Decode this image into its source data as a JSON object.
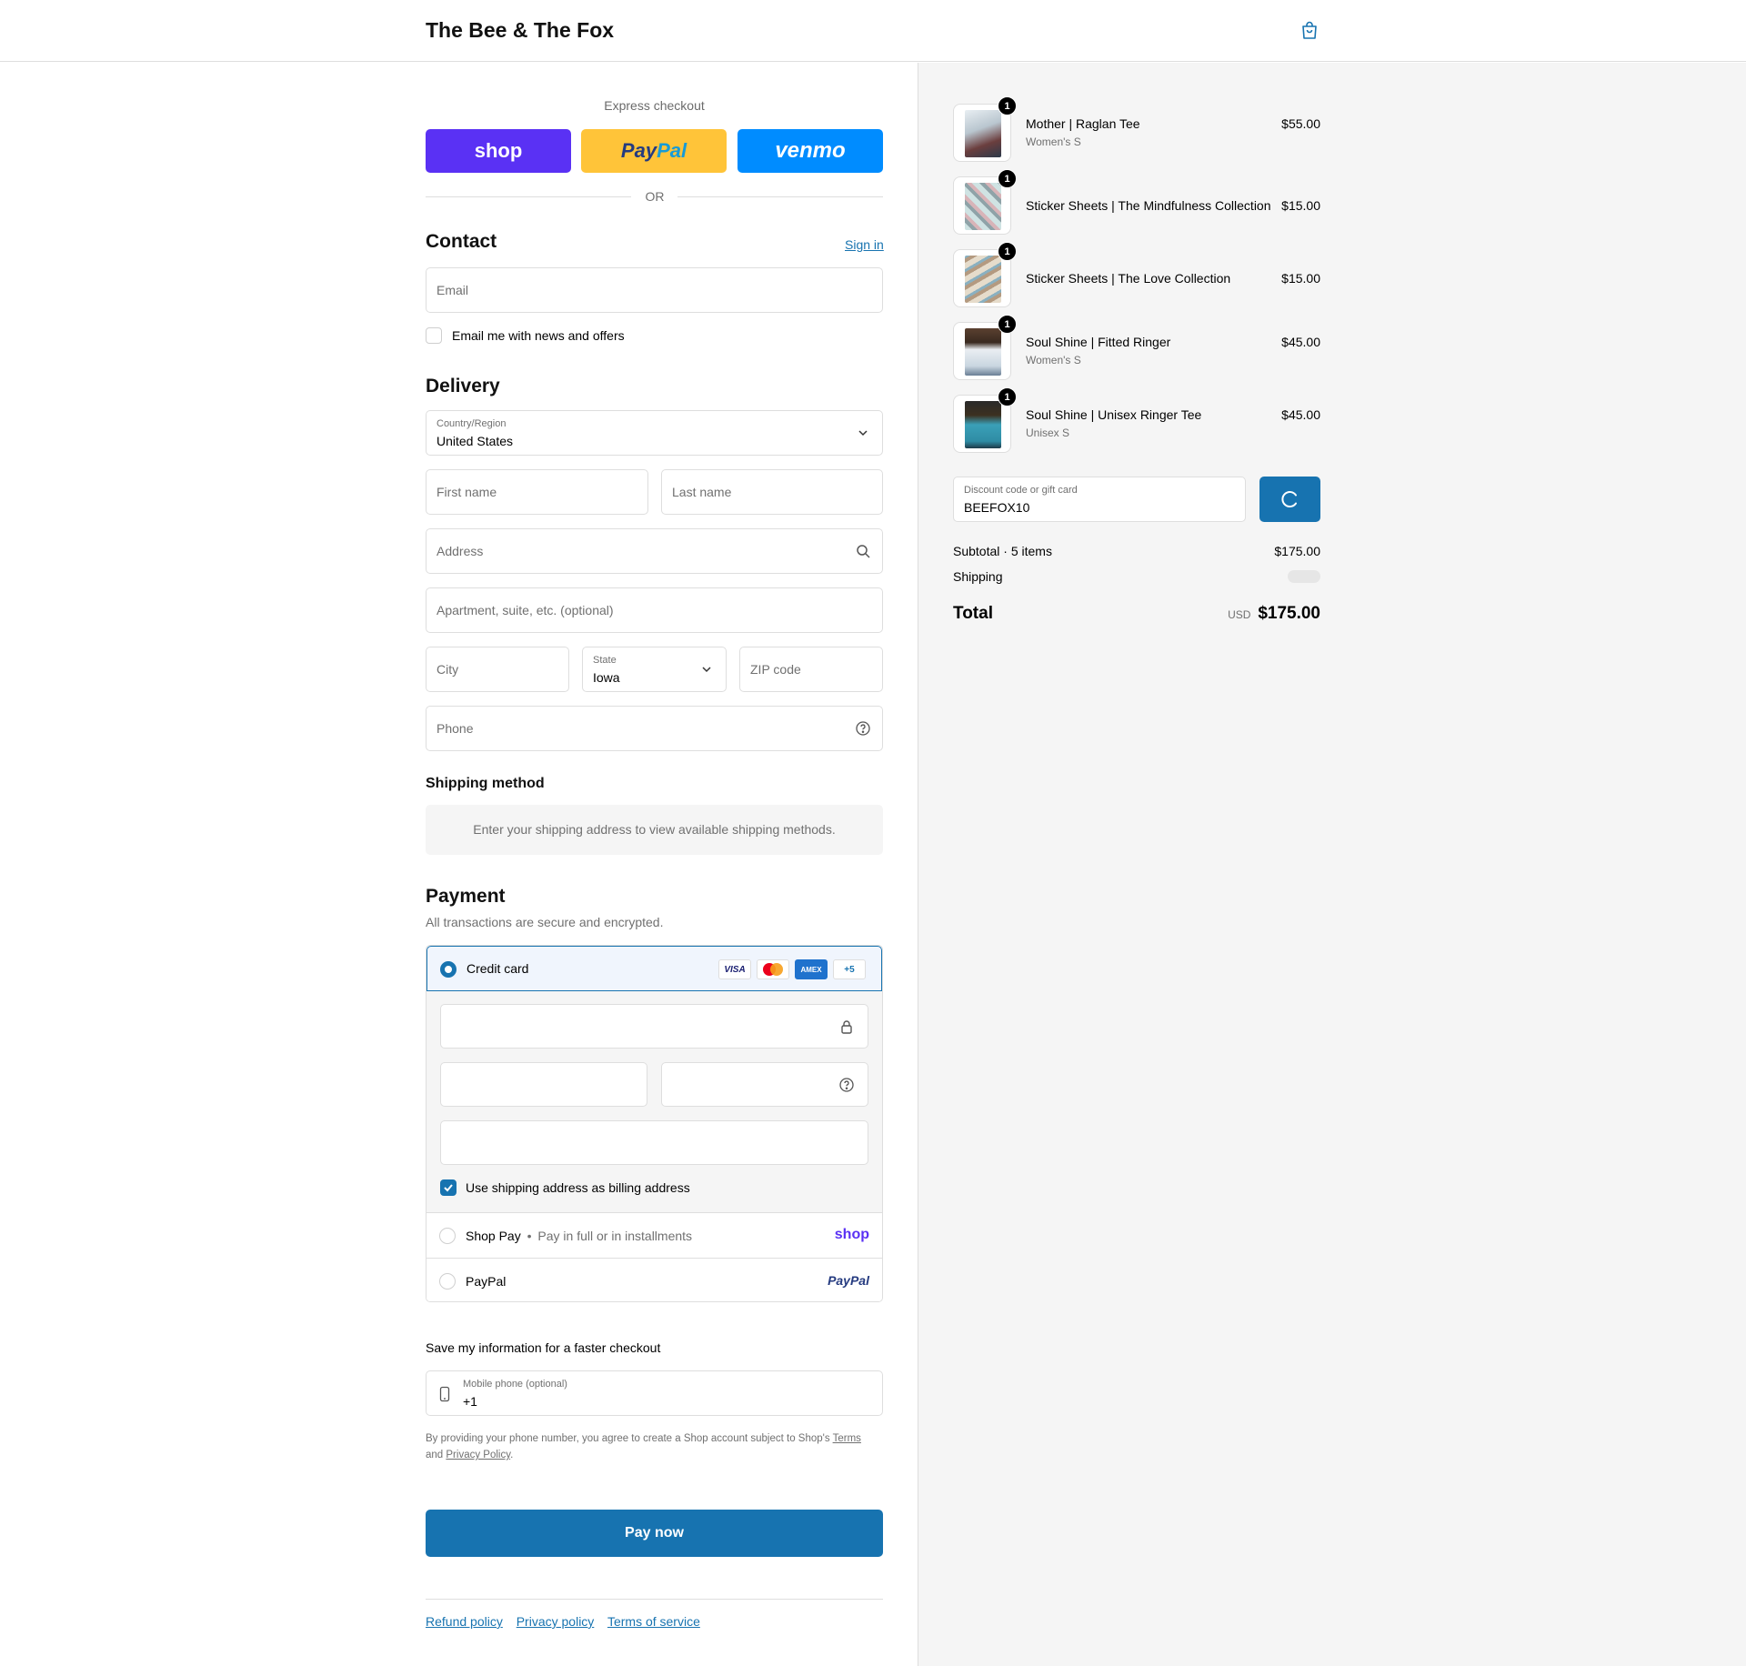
{
  "store": {
    "name": "The Bee & The Fox"
  },
  "express": {
    "title": "Express checkout",
    "shop_label": "shop",
    "paypal_label_a": "Pay",
    "paypal_label_b": "Pal",
    "venmo_label": "venmo",
    "or_label": "OR"
  },
  "contact": {
    "heading": "Contact",
    "sign_in": "Sign in",
    "email_placeholder": "Email",
    "news_label": "Email me with news and offers"
  },
  "delivery": {
    "heading": "Delivery",
    "country_label": "Country/Region",
    "country_value": "United States",
    "first_name": "First name",
    "last_name": "Last name",
    "address": "Address",
    "apartment": "Apartment, suite, etc. (optional)",
    "city": "City",
    "state_label": "State",
    "state_value": "Iowa",
    "zip": "ZIP code",
    "phone": "Phone"
  },
  "shipping_method": {
    "heading": "Shipping method",
    "info": "Enter your shipping address to view available shipping methods."
  },
  "payment": {
    "heading": "Payment",
    "subheading": "All transactions are secure and encrypted.",
    "credit_card_label": "Credit card",
    "card_logos": [
      "VISA",
      "",
      "AMEX",
      "+5"
    ],
    "billing_label": "Use shipping address as billing address",
    "billing_checked": true,
    "shop_pay_label": "Shop Pay",
    "shop_pay_sep": "•",
    "shop_pay_desc": "Pay in full or in installments",
    "shop_pay_logo": "shop",
    "paypal_label": "PayPal",
    "paypal_logo": "PayPal"
  },
  "save_info": {
    "heading": "Save my information for a faster checkout",
    "mobile_label": "Mobile phone (optional)",
    "mobile_value": "+1",
    "legal_prefix": "By providing your phone number, you agree to create a Shop account subject to Shop's",
    "terms": "Terms",
    "and": "and",
    "privacy": "Privacy Policy",
    "period": "."
  },
  "pay_now": "Pay now",
  "footer": {
    "refund": "Refund policy",
    "privacy": "Privacy policy",
    "terms": "Terms of service"
  },
  "cart": {
    "items": [
      {
        "name": "Mother | Raglan Tee",
        "variant": "Women's S",
        "price": "$55.00",
        "qty": "1"
      },
      {
        "name": "Sticker Sheets | The Mindfulness Collection",
        "variant": "",
        "price": "$15.00",
        "qty": "1"
      },
      {
        "name": "Sticker Sheets | The Love Collection",
        "variant": "",
        "price": "$15.00",
        "qty": "1"
      },
      {
        "name": "Soul Shine | Fitted Ringer",
        "variant": "Women's S",
        "price": "$45.00",
        "qty": "1"
      },
      {
        "name": "Soul Shine | Unisex Ringer Tee",
        "variant": "Unisex S",
        "price": "$45.00",
        "qty": "1"
      }
    ],
    "discount_label": "Discount code or gift card",
    "discount_value": "BEEFOX10",
    "subtotal_label": "Subtotal · 5 items",
    "subtotal_value": "$175.00",
    "shipping_label": "Shipping",
    "total_label": "Total",
    "currency": "USD",
    "total_value": "$175.00"
  },
  "colors": {
    "accent": "#1773b0",
    "shop_purple": "#5a31f4",
    "paypal_yellow": "#ffc439",
    "venmo_blue": "#008cff"
  }
}
